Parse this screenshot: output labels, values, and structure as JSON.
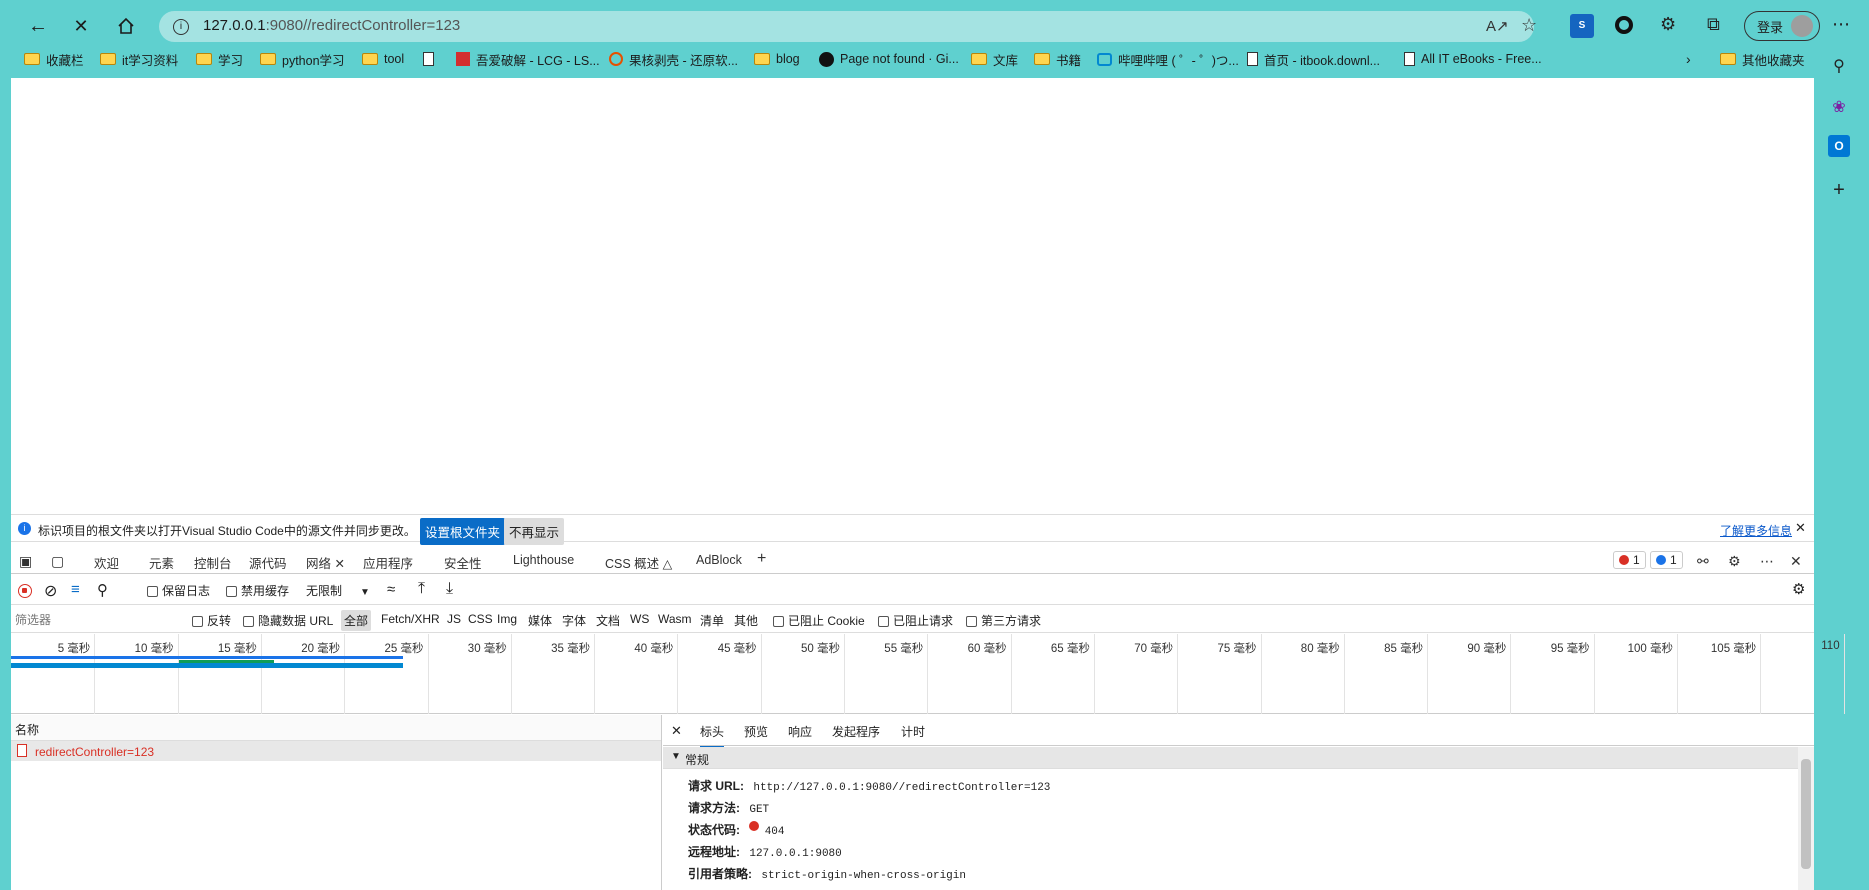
{
  "browser": {
    "url_host": "127.0.0.1",
    "url_rest": ":9080//redirectController=123",
    "login_label": "登录",
    "bookmarks": [
      {
        "label": "收藏栏",
        "icon": "folder-icon"
      },
      {
        "label": "it学习资料",
        "icon": "folder-icon"
      },
      {
        "label": "学习",
        "icon": "folder-icon"
      },
      {
        "label": "python学习",
        "icon": "folder-icon"
      },
      {
        "label": "tool",
        "icon": "folder-icon"
      },
      {
        "label": "",
        "icon": "page-icon"
      },
      {
        "label": "吾爱破解 - LCG - LS...",
        "icon": "site-icon"
      },
      {
        "label": "果核剥壳 - 还原软...",
        "icon": "blocked-icon"
      },
      {
        "label": "blog",
        "icon": "folder-icon"
      },
      {
        "label": "Page not found · Gi...",
        "icon": "github-icon"
      },
      {
        "label": "文库",
        "icon": "folder-icon"
      },
      {
        "label": "书籍",
        "icon": "folder-icon"
      },
      {
        "label": "哔哩哔哩 ( ゜- ゜)つ...",
        "icon": "bilibili-icon"
      },
      {
        "label": "首页 - itbook.downl...",
        "icon": "page-icon"
      },
      {
        "label": "All IT eBooks - Free...",
        "icon": "page-icon"
      },
      {
        "label": "其他收藏夹",
        "icon": "folder-icon"
      }
    ]
  },
  "devtools": {
    "info_text": "标识项目的根文件夹以打开Visual Studio Code中的源文件并同步更改。",
    "set_root_btn": "设置根文件夹",
    "dont_show_btn": "不再显示",
    "learn_more": "了解更多信息",
    "tabs": [
      "欢迎",
      "元素",
      "控制台",
      "源代码",
      "网络",
      "应用程序",
      "安全性",
      "Lighthouse",
      "CSS 概述",
      "AdBlock"
    ],
    "errors_count": "1",
    "messages_count": "1",
    "toolbar": {
      "preserve_log": "保留日志",
      "disable_cache": "禁用缓存",
      "throttle": "无限制"
    },
    "filter": {
      "placeholder": "筛选器",
      "invert": "反转",
      "hide_data_url": "隐藏数据 URL",
      "types": [
        "全部",
        "Fetch/XHR",
        "JS",
        "CSS",
        "Img",
        "媒体",
        "字体",
        "文档",
        "WS",
        "Wasm",
        "清单",
        "其他"
      ],
      "blocked_cookie": "已阻止 Cookie",
      "blocked_requests": "已阻止请求",
      "third_party": "第三方请求"
    },
    "timeline_ticks": [
      "5 毫秒",
      "10 毫秒",
      "15 毫秒",
      "20 毫秒",
      "25 毫秒",
      "30 毫秒",
      "35 毫秒",
      "40 毫秒",
      "45 毫秒",
      "50 毫秒",
      "55 毫秒",
      "60 毫秒",
      "65 毫秒",
      "70 毫秒",
      "75 毫秒",
      "80 毫秒",
      "85 毫秒",
      "90 毫秒",
      "95 毫秒",
      "100 毫秒",
      "105 毫秒",
      "110"
    ],
    "name_header": "名称",
    "request_name": "redirectController=123",
    "detail_tabs": [
      "标头",
      "预览",
      "响应",
      "发起程序",
      "计时"
    ],
    "section": "常规",
    "general": {
      "url_label": "请求 URL:",
      "url": "http://127.0.0.1:9080//redirectController=123",
      "method_label": "请求方法:",
      "method": "GET",
      "status_label": "状态代码:",
      "status": "404",
      "remote_label": "远程地址:",
      "remote": "127.0.0.1:9080",
      "referrer_label": "引用者策略:",
      "referrer": "strict-origin-when-cross-origin"
    }
  }
}
